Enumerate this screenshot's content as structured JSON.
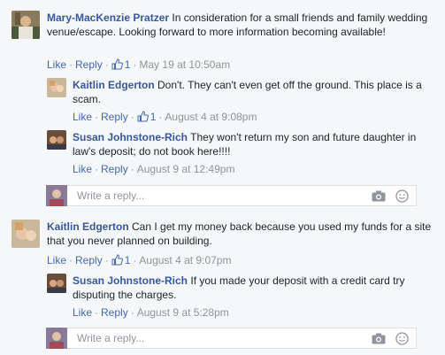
{
  "actions": {
    "like": "Like",
    "reply": "Reply",
    "sep": "·"
  },
  "comments": [
    {
      "author": "Mary-MacKenzie Pratzer",
      "text": "In consideration for a small friends and family wedding venue/escape. Looking forward to more information becoming available!",
      "likes": "1",
      "time": "May 19 at 10:50am",
      "replies": [
        {
          "author": "Kaitlin Edgerton",
          "text": "Don't. They can't even get off the ground. This place is a scam.",
          "likes": "1",
          "time": "August 4 at 9:08pm"
        },
        {
          "author": "Susan Johnstone-Rich",
          "text": "They won't return my son and future daughter in law's deposit; do not book here!!!!",
          "time": "August 9 at 12:49pm"
        }
      ],
      "reply_placeholder": "Write a reply..."
    },
    {
      "author": "Kaitlin Edgerton",
      "text": "Can I get my money back because you used my funds for a site that you never planned on building.",
      "likes": "1",
      "time": "August 4 at 9:07pm",
      "replies": [
        {
          "author": "Susan Johnstone-Rich",
          "text": "If you made your deposit with a credit card try disputing the charges.",
          "time": "August 9 at 5:28pm"
        }
      ],
      "reply_placeholder": "Write a reply..."
    }
  ],
  "colors": {
    "link": "#365899",
    "action": "#4267b2",
    "meta": "#90949c",
    "background": "#f6f7f9"
  },
  "icons": [
    "thumbs-up-icon",
    "camera-icon",
    "emoji-icon"
  ]
}
